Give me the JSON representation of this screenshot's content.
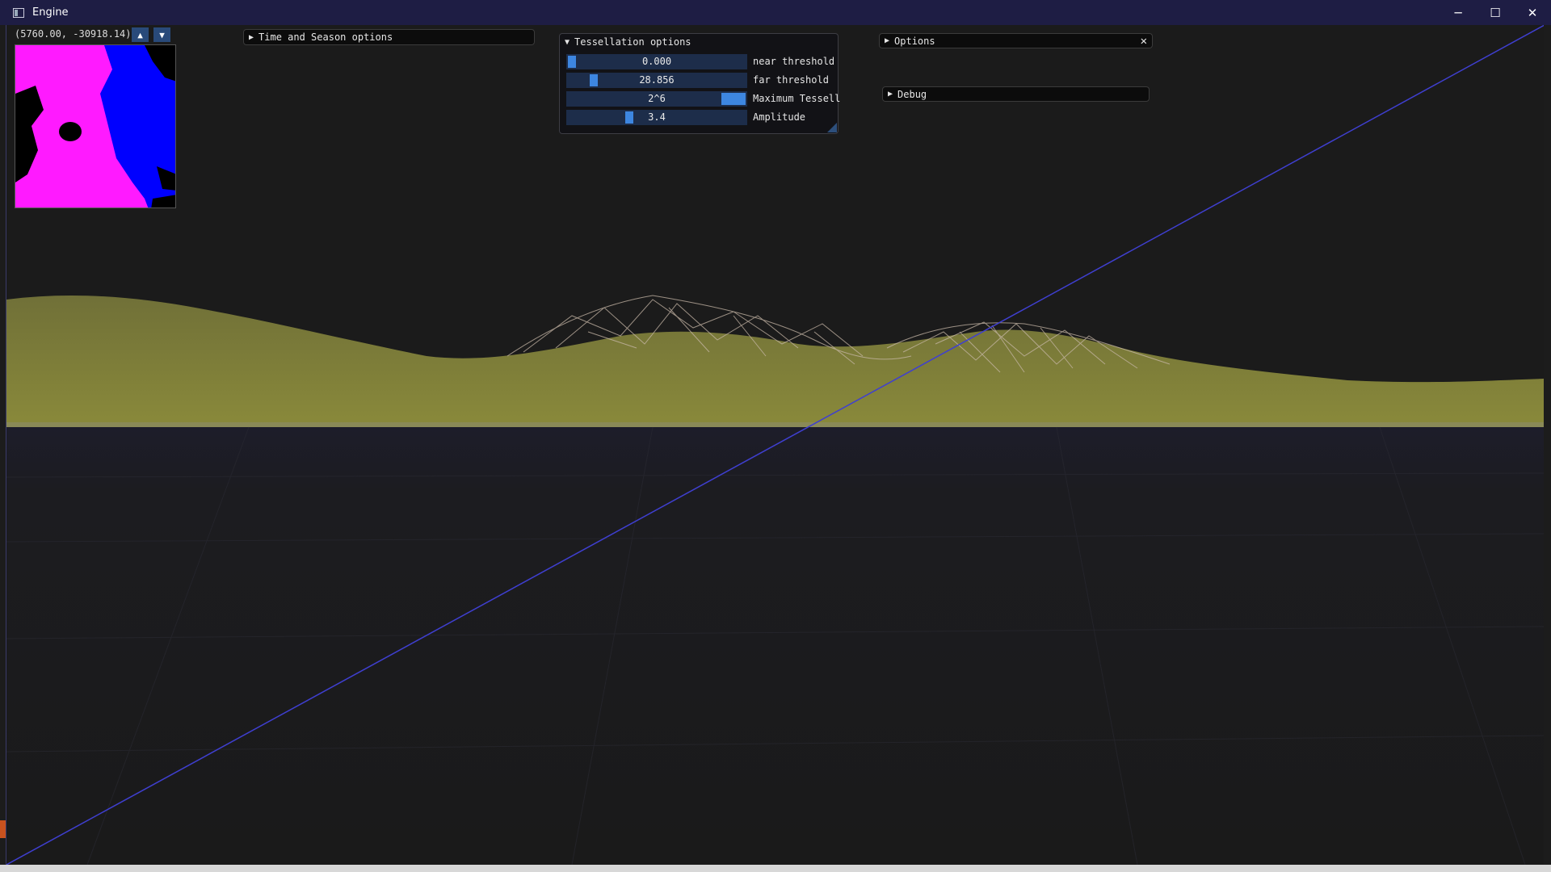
{
  "window": {
    "title": "Engine",
    "controls": {
      "minimize": "─",
      "maximize": "☐",
      "close": "✕"
    }
  },
  "overlay": {
    "coords": "(5760.00, -30918.14)",
    "zoom_up": "▲",
    "zoom_down": "▼"
  },
  "panels": {
    "time_season": {
      "arrow": "▶",
      "label": "Time and Season options"
    },
    "options": {
      "arrow": "▶",
      "label": "Options",
      "close": "✕"
    },
    "debug": {
      "arrow": "▶",
      "label": "Debug"
    }
  },
  "tessellation": {
    "arrow": "▼",
    "title": "Tessellation options",
    "sliders": [
      {
        "label": "near threshold",
        "value": "0.000",
        "fraction": 0.0
      },
      {
        "label": "far threshold",
        "value": "28.856",
        "fraction": 0.13
      },
      {
        "label": "Maximum Tessell",
        "value": "2^6",
        "fraction": 1.0
      },
      {
        "label": "Amplitude",
        "value": "3.4",
        "fraction": 0.34
      }
    ]
  },
  "colors": {
    "titlebar": "#1e1d44",
    "slider_frame": "#1d2d4a",
    "slider_grab": "#3d86e0",
    "terrain": "#6b6a2b",
    "ground": "#1b1b1b",
    "wireframe_line": "#3f3fd0"
  }
}
